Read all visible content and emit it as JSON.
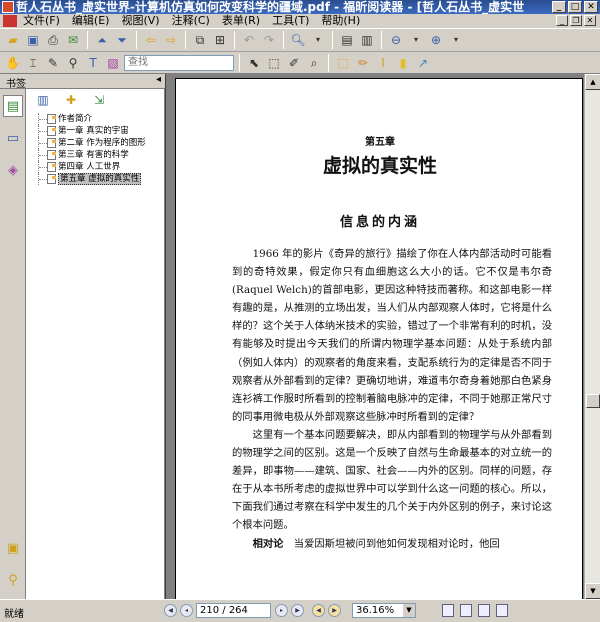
{
  "window": {
    "title": "哲人石丛书_虚实世界-计算机仿真如何改变科学的疆域.pdf - 福昕阅读器 - [哲人石丛书_虚实世"
  },
  "menu": [
    "文件(F)",
    "编辑(E)",
    "视图(V)",
    "注释(C)",
    "表单(R)",
    "工具(T)",
    "帮助(H)"
  ],
  "toolbar2": {
    "search_placeholder": "查找"
  },
  "sidebar": {
    "header": "书签",
    "bookmarks": [
      "作者简介",
      "第一章 真实的宇宙",
      "第二章 作为程序的图形",
      "第三章 有害的科学",
      "第四章 人工世界",
      "第五章 虚拟的真实性"
    ],
    "selected_index": 5
  },
  "page": {
    "chapter_no": "第五章",
    "chapter_title": "虚拟的真实性",
    "section_title": "信息的内涵",
    "paragraphs": [
      "1966 年的影片《奇异的旅行》描绘了你在人体内部活动时可能看到的奇特效果，假定你只有血细胞这么大小的话。它不仅是韦尔奇(Raquel Welch)的首部电影，更因这种特技而著称。和这部电影一样有趣的是，从推测的立场出发，当人们从内部观察人体时，它将是什么样的？这个关于人体纳米技术的实验，错过了一个非常有利的时机，没有能够及时提出今天我们的所谓内物理学基本问题：从处于系统内部（例如人体内）的观察者的角度来看，支配系统行为的定律是否不同于观察者从外部看到的定律？更确切地讲，难道韦尔奇身着她那白色紧身连衫裤工作服时所看到的控制着脑电脉冲的定律，不同于她那正常尺寸的同事用微电极从外部观察这些脉冲时所看到的定律？",
      "这里有一个基本问题要解决，即从内部看到的物理学与从外部看到的物理学之间的区别。这是一个反映了自然与生命最基本的对立统一的差异，即事物——建筑、国家、社会——内外的区别。同样的问题，存在于从本书所考虑的虚拟世界中可以学到什么这一问题的核心。所以，下面我们通过考察在科学中发生的几个关于内外区别的例子，来讨论这个根本问题。"
    ],
    "last_line_bold": "相对论",
    "last_line_rest": "当爱因斯坦被问到他如何发现相对论时，他回"
  },
  "status": {
    "text": "就绪",
    "page_indicator": "210 / 264",
    "zoom": "36.16%"
  }
}
